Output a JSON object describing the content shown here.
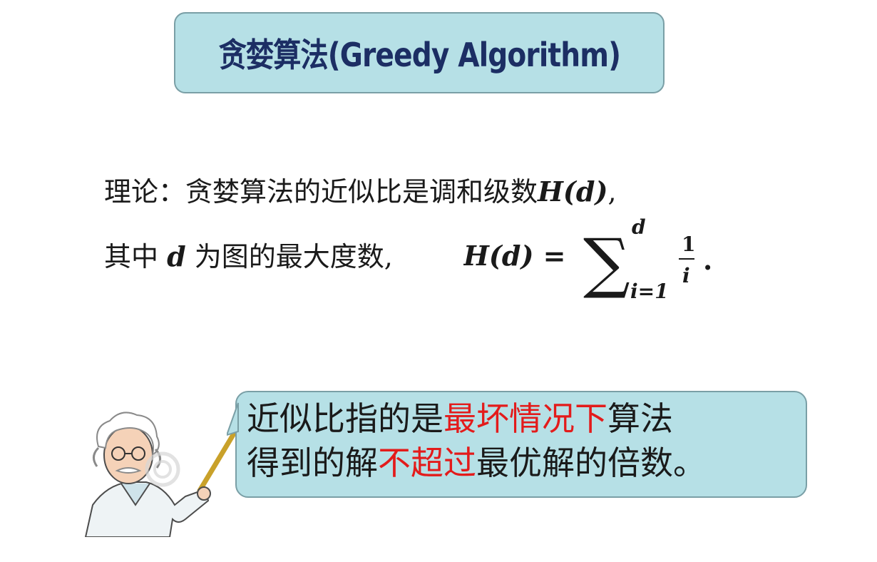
{
  "title": "贪婪算法(Greedy Algorithm)",
  "theory": {
    "prefix": "理论：贪婪算法的近似比是调和级数",
    "hd": "H(d)",
    "suffix": ","
  },
  "definition": {
    "part1": "其中 ",
    "d": "d",
    "part2": " 为图的最大度数,",
    "formula_lhs": "H(d) =",
    "sum_upper": "d",
    "sum_lower": "i=1",
    "frac_num": "1",
    "frac_den": "i",
    "end": "."
  },
  "speech": {
    "line1_a": "近似比指的是",
    "line1_red": "最坏情况下",
    "line1_b": "算法",
    "line2_a": "得到的解",
    "line2_red": "不超过",
    "line2_b": "最优解的倍数。"
  },
  "colors": {
    "highlight": "#e31b1b",
    "box": "#b6e0e6",
    "title": "#1c2e64"
  }
}
